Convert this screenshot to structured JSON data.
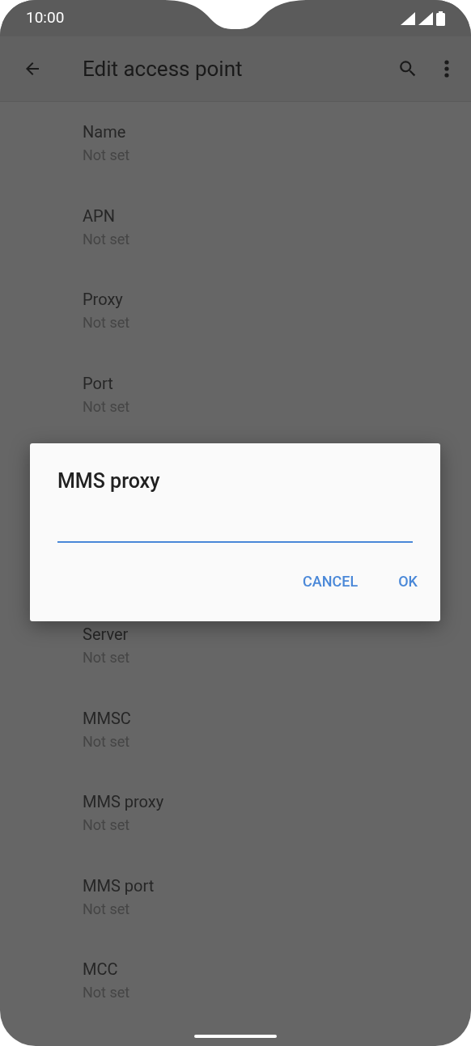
{
  "status_bar": {
    "time": "10:00"
  },
  "toolbar": {
    "title": "Edit access point"
  },
  "list_above_dialog": [
    {
      "label": "Name",
      "value": "Not set"
    },
    {
      "label": "APN",
      "value": "Not set"
    },
    {
      "label": "Proxy",
      "value": "Not set"
    },
    {
      "label": "Port",
      "value": "Not set"
    }
  ],
  "list_below_dialog": [
    {
      "label": "Server",
      "value": "Not set"
    },
    {
      "label": "MMSC",
      "value": "Not set"
    },
    {
      "label": "MMS proxy",
      "value": "Not set"
    },
    {
      "label": "MMS port",
      "value": "Not set"
    },
    {
      "label": "MCC",
      "value": "Not set"
    }
  ],
  "dialog": {
    "title": "MMS proxy",
    "buttons": [
      "CANCEL",
      "OK"
    ]
  }
}
